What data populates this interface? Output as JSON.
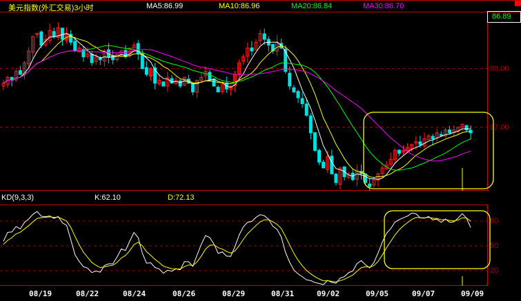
{
  "header": {
    "title": "美元指数(外汇交易)3小时",
    "ma5": "MA5:86.99",
    "ma10": "MA10:86.96",
    "ma20": "MA20:86.84",
    "ma30": "MA30:86.70"
  },
  "last_price": "86.89",
  "price_axis": [
    "88.00",
    "87.00"
  ],
  "kd": {
    "label": "KD(9,3,3)",
    "k": "K:62.10",
    "d": "D:72.13",
    "axis": [
      "80",
      "50",
      "20"
    ]
  },
  "dates": [
    "08/19",
    "08/22",
    "08/24",
    "08/26",
    "08/29",
    "08/31",
    "09/02",
    "09/05",
    "09/07",
    "09/09"
  ],
  "colors": {
    "up": "#ff2020",
    "down": "#00e0e0",
    "ma5": "#ffffff",
    "ma10": "#ffff00",
    "ma20": "#00ff00",
    "ma30": "#ff00ff",
    "grid": "#a00000"
  },
  "chart_data": {
    "type": "candlestick",
    "price_range": [
      85.91,
      88.96
    ],
    "closes": [
      87.75,
      87.85,
      87.8,
      87.95,
      87.9,
      88.1,
      88.3,
      88.55,
      88.6,
      88.4,
      88.5,
      88.65,
      88.55,
      88.7,
      88.5,
      88.6,
      88.45,
      88.3,
      88.35,
      88.2,
      88.25,
      88.1,
      88.2,
      88.15,
      88.3,
      88.2,
      88.15,
      88.25,
      88.3,
      88.2,
      88.35,
      88.4,
      88.25,
      88.0,
      87.9,
      88.0,
      87.75,
      87.8,
      87.7,
      87.85,
      87.75,
      87.8,
      87.7,
      87.85,
      87.75,
      87.6,
      87.8,
      87.85,
      87.95,
      87.8,
      87.7,
      87.6,
      87.75,
      87.65,
      87.7,
      87.9,
      88.1,
      88.2,
      88.35,
      88.3,
      88.45,
      88.6,
      88.5,
      88.4,
      88.3,
      88.45,
      88.35,
      87.95,
      87.7,
      87.6,
      87.5,
      87.4,
      87.2,
      86.9,
      86.6,
      86.4,
      86.3,
      86.5,
      86.2,
      86.05,
      86.3,
      86.15,
      86.2,
      86.1,
      86.25,
      86.2,
      86.05,
      85.98,
      86.1,
      86.2,
      86.3,
      86.35,
      86.45,
      86.6,
      86.55,
      86.6,
      86.65,
      86.7,
      86.75,
      86.7,
      86.8,
      86.85,
      86.8,
      86.9,
      86.85,
      86.95,
      86.9,
      86.95,
      87.0,
      87.05,
      86.95,
      86.9
    ]
  }
}
